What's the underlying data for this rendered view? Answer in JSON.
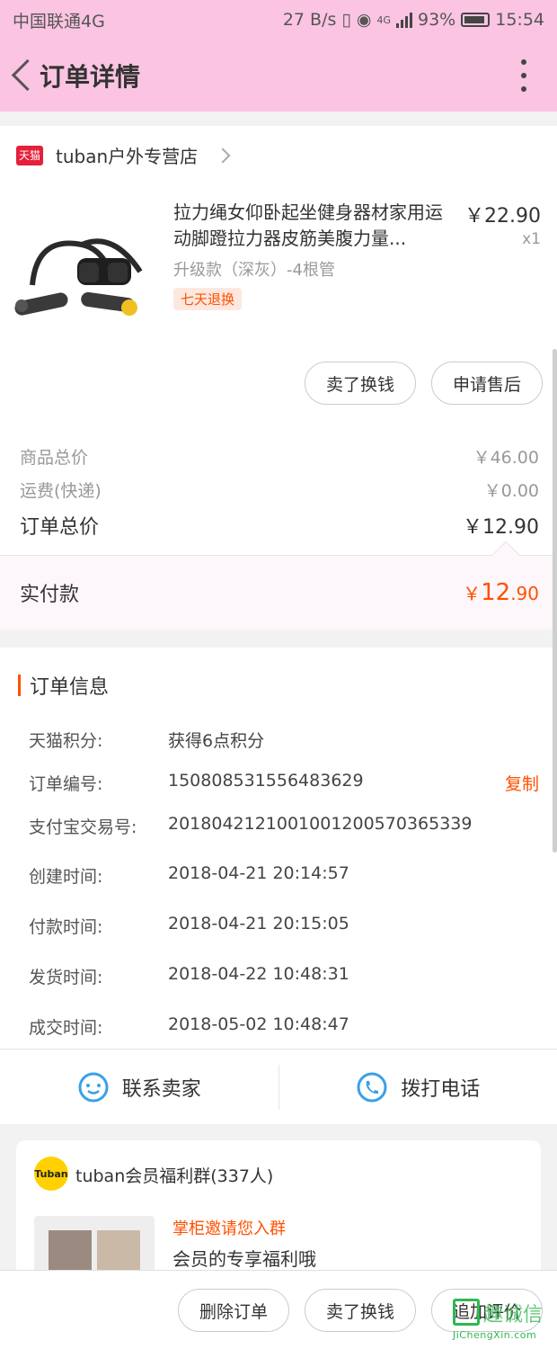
{
  "status": {
    "carrier": "中国联通4G",
    "speed": "27 B/s",
    "battery": "93%",
    "time": "15:54",
    "net_label": "4G"
  },
  "header": {
    "title": "订单详情"
  },
  "shop": {
    "logo": "天猫",
    "name": "tuban户外专营店"
  },
  "product": {
    "title": "拉力绳女仰卧起坐健身器材家用运动脚蹬拉力器皮筋美腹力量...",
    "price": "￥22.90",
    "qty": "x1",
    "spec": "升级款（深灰）-4根管",
    "tag": "七天退换"
  },
  "actions": {
    "refund": "卖了换钱",
    "after_sale": "申请售后"
  },
  "summary": {
    "goods_label": "商品总价",
    "goods_value": "￥46.00",
    "shipping_label": "运费(快递)",
    "shipping_value": "￥0.00",
    "total_label": "订单总价",
    "total_value": "￥12.90",
    "paid_label": "实付款",
    "paid_currency": "￥",
    "paid_int": "12",
    "paid_dec": ".90"
  },
  "order_info": {
    "title": "订单信息",
    "rows": [
      {
        "k": "天猫积分:",
        "v": "获得6点积分"
      },
      {
        "k": "订单编号:",
        "v": "150808531556483629",
        "action": "复制"
      },
      {
        "k": "支付宝交易号:",
        "v": "2018042121001001200570365339"
      },
      {
        "k": "创建时间:",
        "v": "2018-04-21 20:14:57"
      },
      {
        "k": "付款时间:",
        "v": "2018-04-21 20:15:05"
      },
      {
        "k": "发货时间:",
        "v": "2018-04-22 10:48:31"
      },
      {
        "k": "成交时间:",
        "v": "2018-05-02 10:48:47"
      }
    ]
  },
  "contact": {
    "seller": "联系卖家",
    "phone": "拨打电话"
  },
  "group": {
    "logo": "Tuban",
    "name": "tuban会员福利群(337人)",
    "invite": "掌柜邀请您入群",
    "desc": "会员的专享福利哦"
  },
  "bottom": {
    "delete": "删除订单",
    "refund": "卖了换钱",
    "review": "追加评价"
  },
  "watermark": {
    "text": "趣诚信",
    "url": "JiChengXin.com"
  }
}
